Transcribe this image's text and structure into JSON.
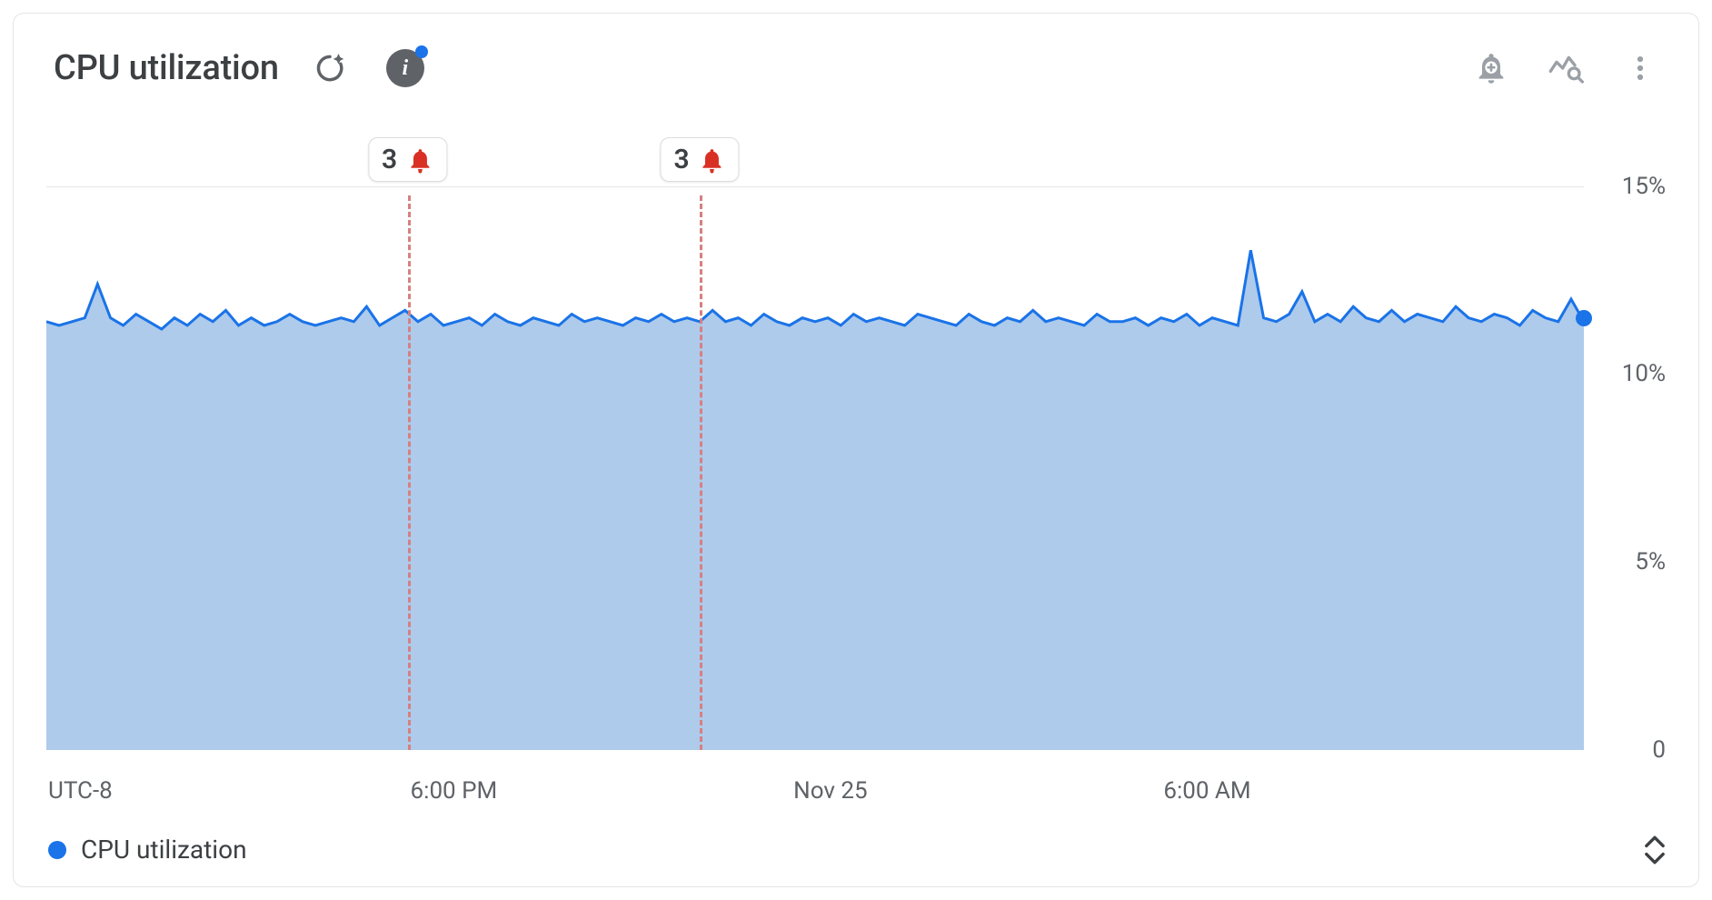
{
  "header": {
    "title": "CPU utilization",
    "icons": {
      "refresh": "refresh-ai-icon",
      "info": "info-icon",
      "alert_add": "add-alert-icon",
      "explore": "explore-metrics-icon",
      "more": "more-vert-icon"
    }
  },
  "chart_data": {
    "type": "area",
    "ylabel": "",
    "xlabel": "",
    "ylim": [
      0,
      15
    ],
    "y_unit": "%",
    "y_ticks": [
      "0",
      "5%",
      "10%",
      "15%"
    ],
    "timezone_label": "UTC-8",
    "x_ticks": [
      {
        "pos_pct": 26.5,
        "label": "6:00 PM"
      },
      {
        "pos_pct": 51.0,
        "label": "Nov 25"
      },
      {
        "pos_pct": 75.5,
        "label": "6:00 AM"
      }
    ],
    "series": [
      {
        "name": "CPU utilization",
        "color": "#1a73e8",
        "fill": "#aecbeb",
        "values": [
          11.4,
          11.3,
          11.4,
          11.5,
          12.4,
          11.5,
          11.3,
          11.6,
          11.4,
          11.2,
          11.5,
          11.3,
          11.6,
          11.4,
          11.7,
          11.3,
          11.5,
          11.3,
          11.4,
          11.6,
          11.4,
          11.3,
          11.4,
          11.5,
          11.4,
          11.8,
          11.3,
          11.5,
          11.7,
          11.4,
          11.6,
          11.3,
          11.4,
          11.5,
          11.3,
          11.6,
          11.4,
          11.3,
          11.5,
          11.4,
          11.3,
          11.6,
          11.4,
          11.5,
          11.4,
          11.3,
          11.5,
          11.4,
          11.6,
          11.4,
          11.5,
          11.4,
          11.7,
          11.4,
          11.5,
          11.3,
          11.6,
          11.4,
          11.3,
          11.5,
          11.4,
          11.5,
          11.3,
          11.6,
          11.4,
          11.5,
          11.4,
          11.3,
          11.6,
          11.5,
          11.4,
          11.3,
          11.6,
          11.4,
          11.3,
          11.5,
          11.4,
          11.7,
          11.4,
          11.5,
          11.4,
          11.3,
          11.6,
          11.4,
          11.4,
          11.5,
          11.3,
          11.5,
          11.4,
          11.6,
          11.3,
          11.5,
          11.4,
          11.3,
          13.3,
          11.5,
          11.4,
          11.6,
          12.2,
          11.4,
          11.6,
          11.4,
          11.8,
          11.5,
          11.4,
          11.7,
          11.4,
          11.6,
          11.5,
          11.4,
          11.8,
          11.5,
          11.4,
          11.6,
          11.5,
          11.3,
          11.7,
          11.5,
          11.4,
          12.0,
          11.4
        ]
      }
    ],
    "events": [
      {
        "pos_pct": 23.5,
        "count": 3,
        "type": "alert"
      },
      {
        "pos_pct": 42.5,
        "count": 3,
        "type": "alert"
      }
    ],
    "end_marker_value": 11.5
  },
  "legend": {
    "items": [
      {
        "label": "CPU utilization",
        "color": "#1a73e8"
      }
    ]
  }
}
